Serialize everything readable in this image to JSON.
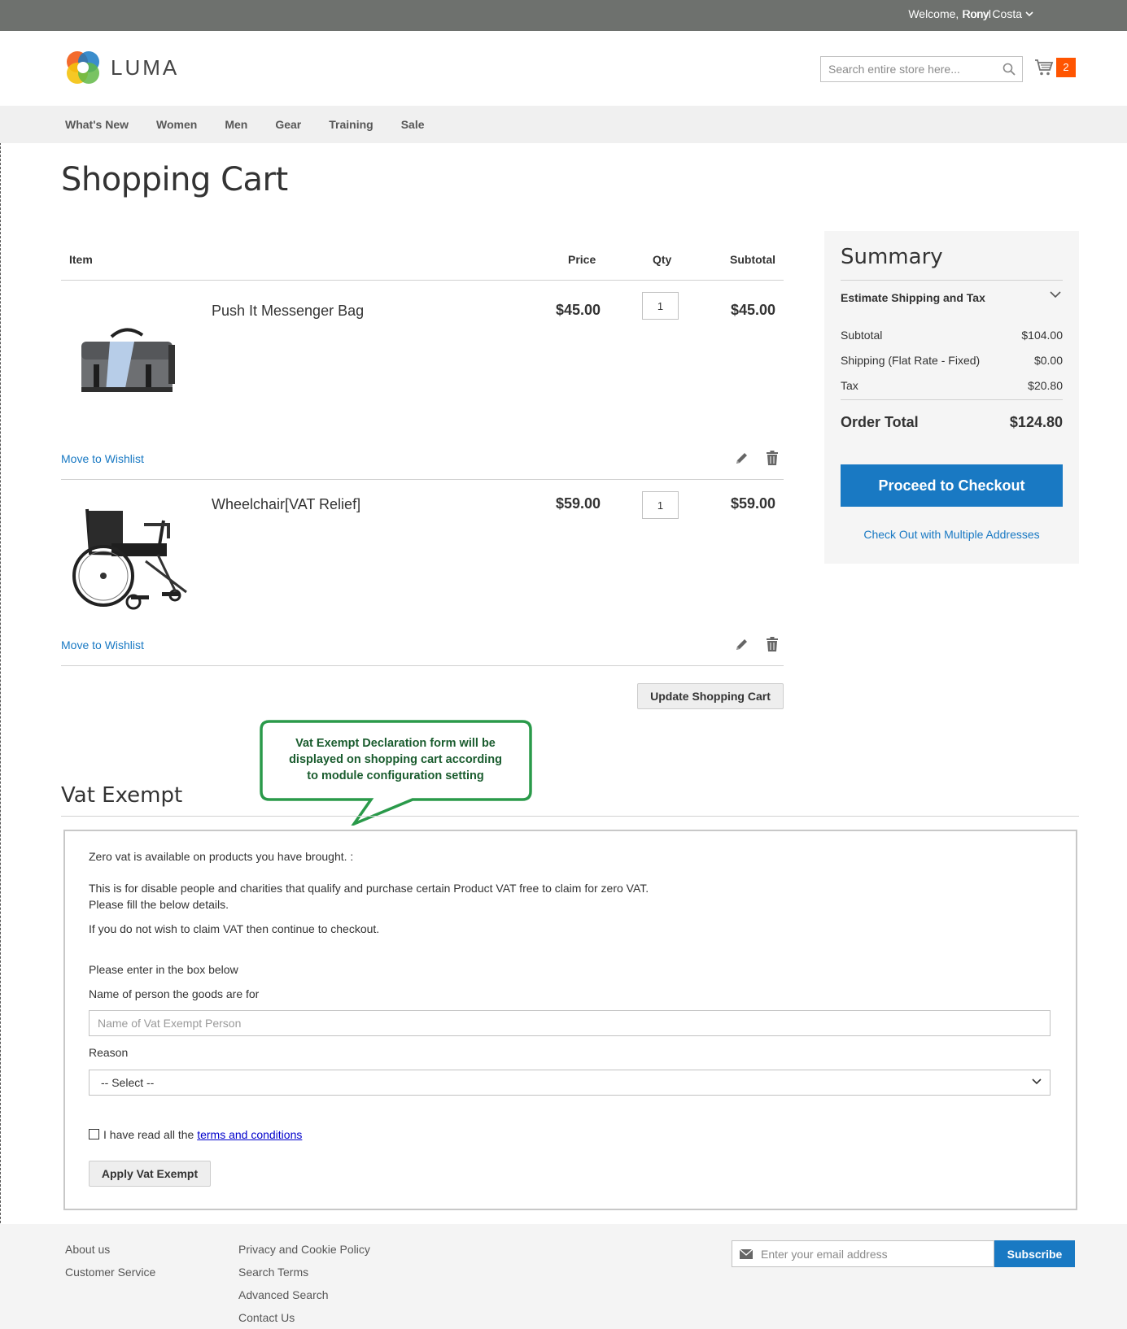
{
  "top_panel": {
    "welcome": "Welcome, Ronyl",
    "account_name": "Rony Costa"
  },
  "header": {
    "logo_text": "LUMA",
    "search_placeholder": "Search entire store here...",
    "cart_count": "2"
  },
  "nav": {
    "items": [
      "What's New",
      "Women",
      "Men",
      "Gear",
      "Training",
      "Sale"
    ]
  },
  "page_title": "Shopping Cart",
  "cart": {
    "headers": {
      "item": "Item",
      "price": "Price",
      "qty": "Qty",
      "subtotal": "Subtotal"
    },
    "items": [
      {
        "name": "Push It Messenger Bag",
        "price": "$45.00",
        "qty": "1",
        "subtotal": "$45.00",
        "wishlist": "Move to Wishlist"
      },
      {
        "name": "Wheelchair[VAT Relief]",
        "price": "$59.00",
        "qty": "1",
        "subtotal": "$59.00",
        "wishlist": "Move to Wishlist"
      }
    ],
    "update_label": "Update Shopping Cart"
  },
  "summary": {
    "title": "Summary",
    "estimate_label": "Estimate Shipping and Tax",
    "lines": [
      {
        "label": "Subtotal",
        "value": "$104.00"
      },
      {
        "label": "Shipping (Flat Rate - Fixed)",
        "value": "$0.00"
      },
      {
        "label": "Tax",
        "value": "$20.80"
      }
    ],
    "order_total_label": "Order Total",
    "order_total_value": "$124.80",
    "checkout_label": "Proceed to Checkout",
    "multi_label": "Check Out with Multiple Addresses"
  },
  "callout": {
    "lines": [
      "Vat Exempt Declaration form will be",
      "displayed on shopping cart according",
      "to module configuration setting"
    ],
    "border_color": "#2a9a4a",
    "text_color": "#1a5c2e"
  },
  "vat": {
    "title": "Vat Exempt",
    "intro": "Zero vat is available on products you have brought. :",
    "desc_1": "This is for disable people and charities that qualify and purchase certain Product VAT free to claim for zero VAT.",
    "desc_2": "Please fill the below details.",
    "desc_3": "If you do not wish to claim VAT then continue to checkout.",
    "enter_label": "Please enter in the box below",
    "name_label": "Name of person the goods are for",
    "name_placeholder": "Name of Vat Exempt Person",
    "reason_label": "Reason",
    "reason_selected": "-- Select --",
    "terms_prefix": "I have read all the",
    "terms_link": "terms and conditions",
    "apply_label": "Apply Vat Exempt"
  },
  "footer": {
    "col1": [
      "About us",
      "Customer Service"
    ],
    "col2": [
      "Privacy and Cookie Policy",
      "Search Terms",
      "Advanced Search",
      "Contact Us"
    ],
    "newsletter_placeholder": "Enter your email address",
    "subscribe_label": "Subscribe"
  },
  "colors": {
    "accent": "#1979c3",
    "counter": "#ff5501",
    "top_bar": "#6e716e"
  }
}
